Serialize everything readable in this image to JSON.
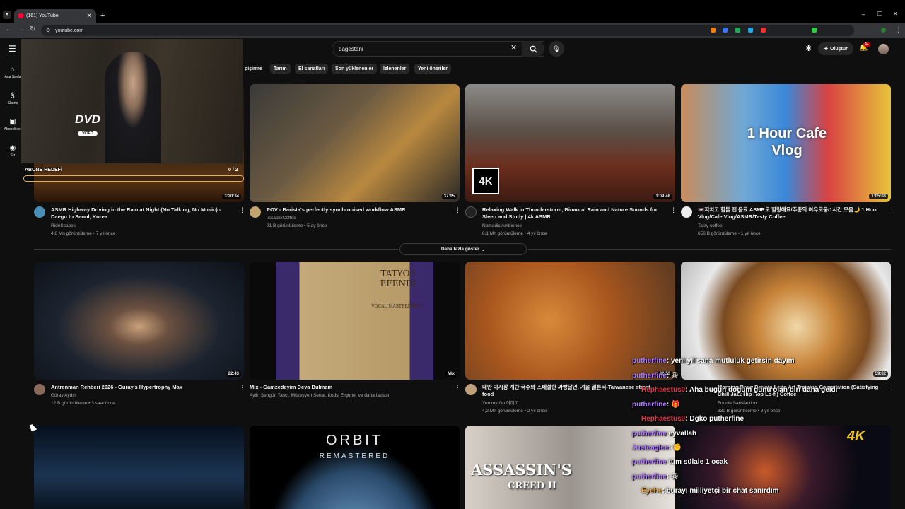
{
  "browser": {
    "tab_title": "(161) YouTube",
    "url": "youtube.com",
    "new_tab": "+",
    "close": "✕"
  },
  "header": {
    "search_value": "dagestani",
    "create_label": "Oluştur",
    "notification_count": "9+"
  },
  "sidebar": {
    "items": [
      {
        "label": "Ana Sayfa",
        "icon": "home-icon"
      },
      {
        "label": "Shorts",
        "icon": "shorts-icon"
      },
      {
        "label": "Abonelikler",
        "icon": "subscriptions-icon"
      },
      {
        "label": "Siz",
        "icon": "you-icon"
      }
    ]
  },
  "chips": [
    "pişirme",
    "Tarım",
    "El sanatları",
    "Son yüklenenler",
    "İzlenenler",
    "Yeni öneriler"
  ],
  "overlay": {
    "dvd_logo": "DVD",
    "dvd_sub": "VIDEO",
    "goal_label": "ABONE HEDEFİ",
    "goal_count": "0  / 2",
    "goal_progress": 0
  },
  "videos_row1": [
    {
      "title": "ASMR Highway Driving in the Rain at Night (No Talking, No Music) - Daegu to Seoul, Korea",
      "channel": "RideScapes",
      "meta": "4,8 Mn görüntüleme • 7 yıl önce",
      "duration": "3:20:34"
    },
    {
      "title": "POV - Barista's perfectly synchronised workflow ASMR",
      "channel": "lissackxCoffee",
      "meta": "21 B görüntüleme • 5 ay önce",
      "duration": "37:05"
    },
    {
      "title": "Relaxing Walk in Thunderstorm, Binaural Rain and Nature Sounds for Sleep and Study | 4k ASMR",
      "channel": "Nomadic Ambience",
      "meta": "8,1 Mn görüntüleme • 4 yıl önce",
      "duration": "1:09:48",
      "badge": "4K"
    },
    {
      "title": "📼지치고 힘들 땐 음료 ASMR로 힐링해요/주중의 여유로움/1시간 모음🌙 1 Hour Vlog/Cafe Vlog/ASMR/Tasty Coffee",
      "channel": "Tasty coffee",
      "meta": "656 B görüntüleme • 1 yıl önce",
      "duration": "1:05:03",
      "thumb_text": "1 Hour Cafe Vlog"
    }
  ],
  "more_label": "Daha fazla göster",
  "videos_row2": [
    {
      "title": "Antrenman Rehberi 2026 - Guray's Hypertrophy Max",
      "channel": "Güray Aydın",
      "meta": "12 B görüntüleme • 3 saat önce",
      "duration": "22:43"
    },
    {
      "title": "Mix - Gamzedeyim Deva Bulmam",
      "channel": "Aylin Şengün Taşçı, Müzeyyen Senar, Kudsi Erguner ve daha fazlası",
      "meta": "",
      "duration": "Mix",
      "thumb_title": "TATYOS EFENDI",
      "thumb_sub": "VOCAL MASTERPIECES"
    },
    {
      "title": "대만 야시장 계란 국수와 스페셜한 짜빵달인, 겨울 델론티-Taiwanese street food",
      "channel": "Yummy Go 야미고",
      "meta": "4,2 Mn görüntüleme • 2 yıl önce",
      "duration": "32:53"
    },
    {
      "title": "Morning Brew Barista Latte Art Training Compilation (Satisfying Chill Jazz Hip Hop Lo-fi) Coffee",
      "channel": "Foodie Satisfaction",
      "meta": "330 B görüntüleme • 8 yıl önce",
      "duration": "59:02"
    }
  ],
  "videos_row3": [
    {
      "thumb_text": ""
    },
    {
      "thumb_text": "ORBIT",
      "thumb_sub": "REMASTERED"
    },
    {
      "thumb_text": "ASSASSIN'S",
      "thumb_sub": "CREED II"
    },
    {
      "thumb_text": "4K"
    }
  ],
  "chat": [
    {
      "user": "putherfine",
      "msg": ": yeni yıl sana mutluluk getirsin dayım",
      "color": "purple"
    },
    {
      "user": "putherfine",
      "msg": ": 😀",
      "color": "purple"
    },
    {
      "user": "Hephaestus0",
      "msg": ": Aha bugün doğum günü olan biri daha geldi",
      "color": "red"
    },
    {
      "user": "putherfine",
      "msg": ": 🎁",
      "color": "purple"
    },
    {
      "user": "Hephaestus0",
      "msg": ": Dgko putherfine",
      "color": "red"
    },
    {
      "user": "putherfine",
      "msg": " eyvallah",
      "color": "purple"
    },
    {
      "user": "Justeaglee",
      "msg": ": ✊",
      "color": "purple"
    },
    {
      "user": "putherfine",
      "msg": " tüm sülale 1 ocak",
      "color": "purple"
    },
    {
      "user": "putherfine",
      "msg": ": 😀",
      "color": "purple"
    },
    {
      "user": "Eyehe",
      "msg": ": burayı milliyetçi bir chat sanırdım",
      "color": "orange"
    }
  ]
}
